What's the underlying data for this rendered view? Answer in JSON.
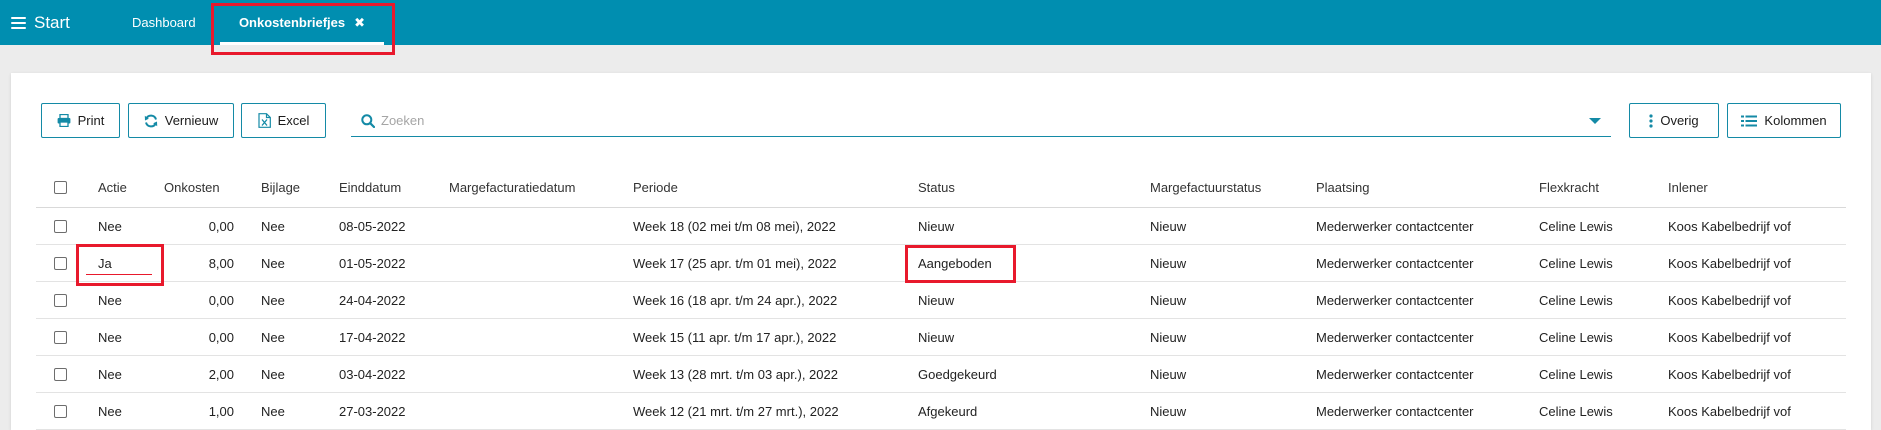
{
  "topbar": {
    "start_label": "Start",
    "tabs": [
      {
        "label": "Dashboard"
      },
      {
        "label": "Onkostenbriefjes",
        "close_icon": "close-icon"
      }
    ],
    "bg_color": "#008eb0"
  },
  "toolbar": {
    "print_label": "Print",
    "vernieuw_label": "Vernieuw",
    "excel_label": "Excel",
    "overig_label": "Overig",
    "kolommen_label": "Kolommen"
  },
  "search": {
    "placeholder": "Zoeken",
    "value": ""
  },
  "table": {
    "columns": [
      "Actie",
      "Onkosten",
      "Bijlage",
      "Einddatum",
      "Margefacturatiedatum",
      "Periode",
      "Status",
      "Margefactuurstatus",
      "Plaatsing",
      "Flexkracht",
      "Inlener"
    ],
    "rows": [
      {
        "actie": "Nee",
        "onkosten": "0,00",
        "bijlage": "Nee",
        "einddatum": "08-05-2022",
        "margefacturatiedatum": "",
        "periode": "Week 18 (02 mei t/m 08 mei), 2022",
        "status": "Nieuw",
        "margefactuurstatus": "Nieuw",
        "plaatsing": "Mederwerker contactcenter",
        "flexkracht": "Celine Lewis",
        "inlener": "Koos Kabelbedrijf vof"
      },
      {
        "actie": "Ja",
        "onkosten": "8,00",
        "bijlage": "Nee",
        "einddatum": "01-05-2022",
        "margefacturatiedatum": "",
        "periode": "Week 17 (25 apr. t/m 01 mei), 2022",
        "status": "Aangeboden",
        "margefactuurstatus": "Nieuw",
        "plaatsing": "Mederwerker contactcenter",
        "flexkracht": "Celine Lewis",
        "inlener": "Koos Kabelbedrijf vof"
      },
      {
        "actie": "Nee",
        "onkosten": "0,00",
        "bijlage": "Nee",
        "einddatum": "24-04-2022",
        "margefacturatiedatum": "",
        "periode": "Week 16 (18 apr. t/m 24 apr.), 2022",
        "status": "Nieuw",
        "margefactuurstatus": "Nieuw",
        "plaatsing": "Mederwerker contactcenter",
        "flexkracht": "Celine Lewis",
        "inlener": "Koos Kabelbedrijf vof"
      },
      {
        "actie": "Nee",
        "onkosten": "0,00",
        "bijlage": "Nee",
        "einddatum": "17-04-2022",
        "margefacturatiedatum": "",
        "periode": "Week 15 (11 apr. t/m 17 apr.), 2022",
        "status": "Nieuw",
        "margefactuurstatus": "Nieuw",
        "plaatsing": "Mederwerker contactcenter",
        "flexkracht": "Celine Lewis",
        "inlener": "Koos Kabelbedrijf vof"
      },
      {
        "actie": "Nee",
        "onkosten": "2,00",
        "bijlage": "Nee",
        "einddatum": "03-04-2022",
        "margefacturatiedatum": "",
        "periode": "Week 13 (28 mrt. t/m 03 apr.), 2022",
        "status": "Goedgekeurd",
        "margefactuurstatus": "Nieuw",
        "plaatsing": "Mederwerker contactcenter",
        "flexkracht": "Celine Lewis",
        "inlener": "Koos Kabelbedrijf vof"
      },
      {
        "actie": "Nee",
        "onkosten": "1,00",
        "bijlage": "Nee",
        "einddatum": "27-03-2022",
        "margefacturatiedatum": "",
        "periode": "Week 12 (21 mrt. t/m 27 mrt.), 2022",
        "status": "Afgekeurd",
        "margefactuurstatus": "Nieuw",
        "plaatsing": "Mederwerker contactcenter",
        "flexkracht": "Celine Lewis",
        "inlener": "Koos Kabelbedrijf vof"
      }
    ]
  },
  "colors": {
    "accent": "#148aa6",
    "highlight": "#e8192c"
  }
}
